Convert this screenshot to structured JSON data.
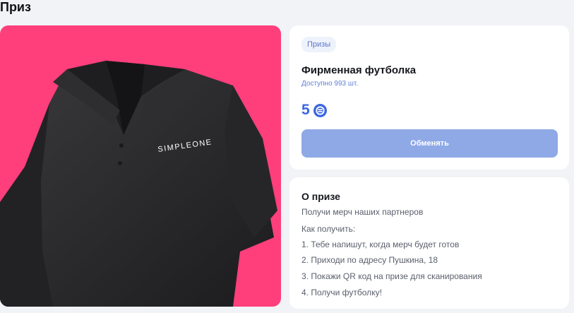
{
  "page": {
    "title": "Приз"
  },
  "product": {
    "image_logo_text": "SIMPLEONE",
    "category_badge": "Призы",
    "name": "Фирменная футболка",
    "availability": "Доступно 993 шт.",
    "price": "5",
    "currency_icon": "coin-icon",
    "exchange_button": "Обменять"
  },
  "about": {
    "title": "О призе",
    "description": "Получи мерч наших партнеров",
    "how_to_label": "Как получить:",
    "steps": [
      "1. Тебе напишут, когда мерч будет готов",
      "2. Приходи по адресу Пушкина, 18",
      "3. Покажи QR код на призе для сканирования",
      "4. Получи футболку!"
    ]
  },
  "colors": {
    "image_background": "#ff3f7c",
    "accent": "#3d67e0",
    "button": "#8fa9e6",
    "page_background": "#f2f3f6"
  }
}
